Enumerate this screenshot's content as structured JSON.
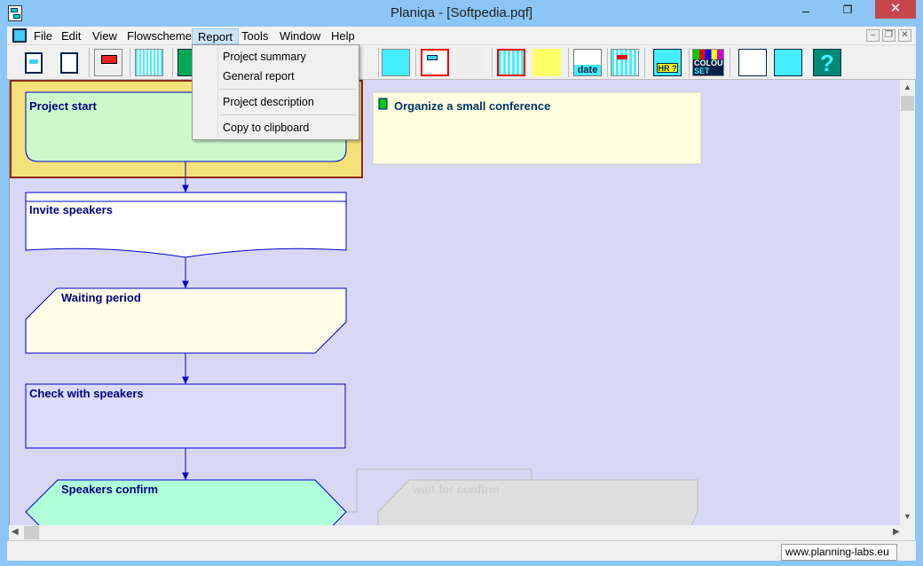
{
  "window": {
    "title": "Planiqa - [Softpedia.pqf]",
    "close": "✕"
  },
  "menubar": {
    "items": [
      "File",
      "Edit",
      "View",
      "Flowscheme",
      "Report",
      "Tools",
      "Window",
      "Help"
    ],
    "mdi": [
      "–",
      "❐",
      "✕"
    ]
  },
  "toolbar": {
    "icons": [
      "new-flowscheme",
      "new-document",
      "open",
      "gantt",
      "save",
      "flowchart-layout",
      "edit-task",
      "connector",
      "task-frame",
      "organize",
      "date",
      "schedule",
      "hr",
      "colour-set",
      "vertical-layout",
      "horizontal-layout",
      "help"
    ],
    "labels": {
      "date": "date",
      "hr": "HR ?",
      "colour": "COLOUR",
      "set": "SET",
      "help": "?"
    }
  },
  "report_menu": {
    "items": [
      "Project summary",
      "General report",
      "Project description",
      "Copy to clipboard"
    ]
  },
  "flowscheme": {
    "project_title": "Organize a small conference",
    "tasks": [
      "Project start",
      "Invite speakers",
      "Waiting period",
      "Check with speakers",
      "Speakers confirm",
      "wait for confirm"
    ]
  },
  "colors": {
    "canvas": "#d8d8f4",
    "selected": "#f3e27a",
    "link": "#0000cc"
  },
  "statusbar": {
    "url": "www.planning-labs.eu"
  }
}
